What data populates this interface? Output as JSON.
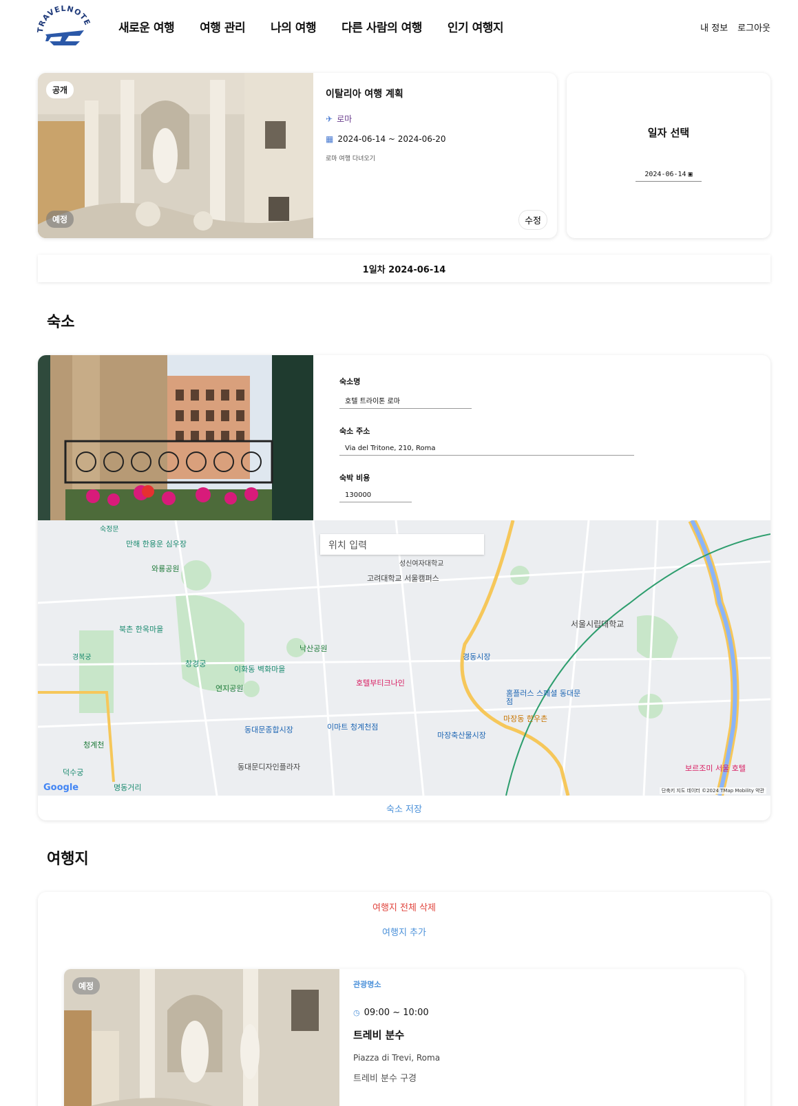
{
  "header": {
    "logo_text": "TRAVELNOTE",
    "nav": [
      "새로운 여행",
      "여행 관리",
      "나의 여행",
      "다른 사람의 여행",
      "인기 여행지"
    ],
    "user_links": [
      "내 정보",
      "로그아웃"
    ]
  },
  "trip": {
    "visibility": "공개",
    "status": "예정",
    "title": "이탈리아 여행 계획",
    "city": "로마",
    "dates": "2024-06-14 ~ 2024-06-20",
    "description": "로마 여행 다녀오기",
    "edit_label": "수정"
  },
  "date_select": {
    "title": "일자 선택",
    "value": "2024-06-14"
  },
  "day_bar": "1일차 2024-06-14",
  "accommodation": {
    "section_title": "숙소",
    "name_label": "숙소명",
    "name_value": "호텔 트라이톤 로마",
    "address_label": "숙소 주소",
    "address_value": "Via del Tritone, 210, Roma",
    "cost_label": "숙박 비용",
    "cost_value": "130000",
    "map_search_placeholder": "위치 입력",
    "map_attribution": "단축키  지도 데이터 ©2024 TMap Mobility  약관",
    "google_logo": "Google",
    "map_labels": [
      "숙정문",
      "만해 한용운 심우장",
      "와룡공원",
      "성신여자대학교",
      "고려대학교 서울캠퍼스",
      "북촌 한옥마을",
      "경복궁",
      "창경궁",
      "낙산공원",
      "이화동 벽화마을",
      "연지공원",
      "호텔부티크나인",
      "경동시장",
      "서울시립대학교",
      "홈플러스 스페셜 동대문점",
      "마장동 한우촌",
      "이마트 청계천점",
      "마장축산물시장",
      "동대문종합시장",
      "동대문디자인플라자",
      "청계천",
      "덕수궁",
      "명동거리",
      "보르조미 서울 호텔"
    ],
    "save_label": "숙소 저장"
  },
  "places": {
    "section_title": "여행지",
    "delete_all_label": "여행지 전체 삭제",
    "add_label": "여행지 추가",
    "items": [
      {
        "status": "예정",
        "category": "관광명소",
        "time": "09:00 ~ 10:00",
        "name": "트레비 분수",
        "address": "Piazza di Trevi, Roma",
        "description": "트레비 분수 구경"
      }
    ]
  },
  "colors": {
    "accent_blue": "#4a90d9",
    "danger_red": "#e0443d",
    "logo_navy": "#1f3a7a"
  }
}
